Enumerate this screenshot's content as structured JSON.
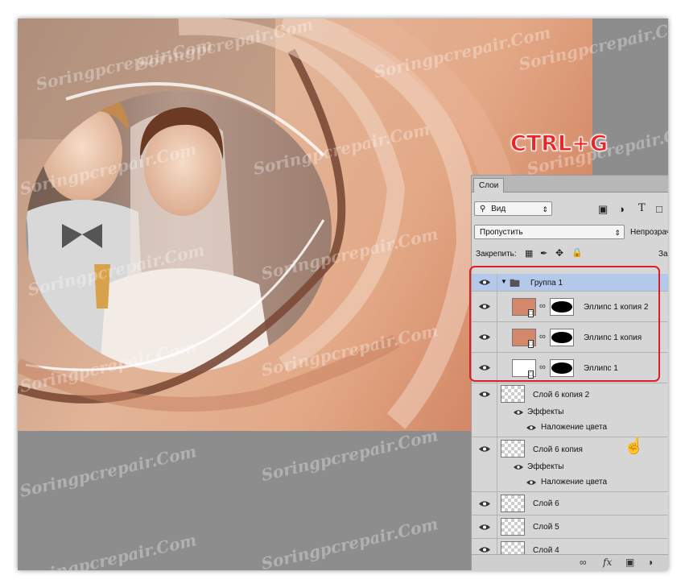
{
  "shortcut_label": "CTRL+G",
  "watermark_text": "Soringpcrepair.Com",
  "panel": {
    "tab_label": "Слои",
    "filter_select": "Вид",
    "blend_mode": "Пропустить",
    "opacity_label": "Непрозрачн",
    "lock_label": "Закрепить:",
    "fill_label_partial": "За",
    "filter_icons": [
      "image-icon",
      "adjustment-icon",
      "type-icon",
      "shape-icon"
    ],
    "lock_icons": [
      "lock-transparent-icon",
      "lock-brush-icon",
      "lock-move-icon",
      "lock-all-icon"
    ]
  },
  "layers": [
    {
      "name": "Группа 1",
      "kind": "group",
      "selected": true
    },
    {
      "name": "Эллипс 1 копия 2",
      "kind": "ellipse",
      "thumb_color": "#d4876a"
    },
    {
      "name": "Эллипс 1 копия",
      "kind": "ellipse",
      "thumb_color": "#d4876a"
    },
    {
      "name": "Эллипс 1",
      "kind": "ellipse",
      "thumb_color": "#ffffff"
    },
    {
      "name": "Слой 6 копия 2",
      "kind": "layer",
      "effects_label": "Эффекты",
      "effect_name": "Наложение цвета"
    },
    {
      "name": "Слой 6 копия",
      "kind": "layer",
      "effects_label": "Эффекты",
      "effect_name": "Наложение цвета"
    },
    {
      "name": "Слой 6",
      "kind": "layer"
    },
    {
      "name": "Слой 5",
      "kind": "layer"
    },
    {
      "name": "Слой 4",
      "kind": "layer"
    }
  ],
  "bottom_icons": [
    "link-icon",
    "fx-icon",
    "mask-icon",
    "adjustment-icon"
  ],
  "bottom_labels": {
    "fx": "fx"
  },
  "colors": {
    "highlight": "#e01d24",
    "selected_row": "#b4c8ea",
    "shortcut_text": "#ee2424"
  }
}
